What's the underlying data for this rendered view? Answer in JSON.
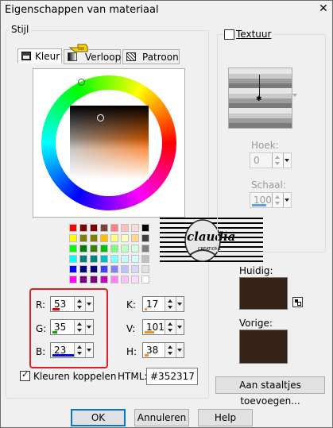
{
  "window": {
    "title": "Eigenschappen van materiaal",
    "close_glyph": "✕"
  },
  "stijl": {
    "label": "Stijl",
    "tabs": [
      {
        "label": "Kleur",
        "icon": "color-tab-icon",
        "active": true
      },
      {
        "label": "Verloop",
        "icon": "gradient-tab-icon",
        "active": false
      },
      {
        "label": "Patroon",
        "icon": "pattern-tab-icon",
        "active": false
      }
    ]
  },
  "picker": {
    "hue_marker_color": "#b46a2e",
    "square_color": "#ff6a00"
  },
  "palette": {
    "rows": [
      [
        "#ff0000",
        "#7f0000",
        "#7f0000",
        "#7f3f3f",
        "#ff7f7f",
        "#ffbfbf",
        "#ffd8d8",
        "#000000"
      ],
      [
        "#ffff00",
        "#7f7f00",
        "#7f7f00",
        "#ffbf00",
        "#ffff7f",
        "#ffffbf",
        "#ffd890",
        "#3f3f3f"
      ],
      [
        "#00ff00",
        "#007f00",
        "#3f7f00",
        "#00bf00",
        "#7fff7f",
        "#bfffbf",
        "#d8ffd8",
        "#7f7f7f"
      ],
      [
        "#00ffff",
        "#007f7f",
        "#007f7f",
        "#00bfbf",
        "#7fffff",
        "#bfffff",
        "#d8ffff",
        "#bfbfbf"
      ],
      [
        "#0000ff",
        "#00007f",
        "#00007f",
        "#3f3fff",
        "#7f7fff",
        "#bfbfff",
        "#d8d8ff",
        "#e0e0e0"
      ],
      [
        "#ff00ff",
        "#7f007f",
        "#7f007f",
        "#bf00bf",
        "#ff7fff",
        "#ffbfff",
        "#ffd8ff",
        "#ffffff"
      ]
    ]
  },
  "watermark": {
    "text": "claudia",
    "subtext": "CREATIONS"
  },
  "rgb": {
    "r": {
      "label": "R:",
      "value": "53",
      "bar_color": "#e00000",
      "fraction": 0.21
    },
    "g": {
      "label": "G:",
      "value": "35",
      "bar_color": "#00b000",
      "fraction": 0.14
    },
    "b": {
      "label": "B:",
      "value": "23",
      "bar_color": "#0000e0",
      "fraction": 0.09
    }
  },
  "hsl": {
    "k": {
      "label": "K:",
      "value": "17",
      "bar_color": "#ff8c28",
      "fraction": 0.07
    },
    "v": {
      "label": "V:",
      "value": "101",
      "bar_color": "#ff8c28",
      "fraction": 0.4
    },
    "h": {
      "label": "H:",
      "value": "38",
      "bar_color": "#ff8c28",
      "fraction": 0.15
    }
  },
  "link": {
    "label": "Kleuren koppelen",
    "checked": true
  },
  "html_field": {
    "label": "HTML:",
    "value": "#352317"
  },
  "texture": {
    "checkbox_label": "Textuur",
    "hoek_label": "Hoek:",
    "hoek_value": "0",
    "schaal_label": "Schaal:",
    "schaal_value": "100"
  },
  "current": {
    "label": "Huidig:",
    "color": "#352317"
  },
  "previous": {
    "label": "Vorige:",
    "color": "#352317"
  },
  "buttons": {
    "add_swatch": "Aan staaltjes toevoegen...",
    "ok": "OK",
    "cancel": "Annuleren",
    "help": "Help"
  },
  "highlight_color": "#e02020"
}
